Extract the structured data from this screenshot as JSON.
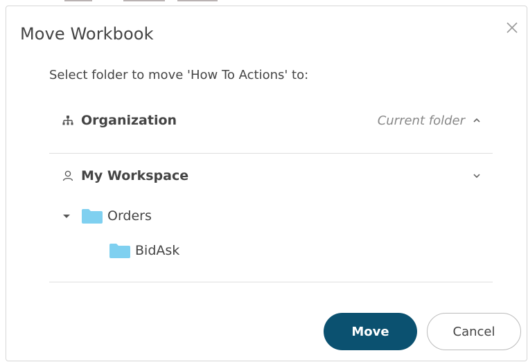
{
  "dialog": {
    "title": "Move Workbook",
    "prompt": "Select folder to move 'How To Actions' to:"
  },
  "folders": {
    "organization": {
      "label": "Organization",
      "status": "Current folder",
      "icon": "org-chart-icon"
    },
    "my_workspace": {
      "label": "My Workspace",
      "icon": "user-icon",
      "children": [
        {
          "label": "Orders",
          "expanded": true,
          "icon": "folder-icon"
        },
        {
          "label": "BidAsk",
          "icon": "folder-icon"
        }
      ]
    }
  },
  "buttons": {
    "move": "Move",
    "cancel": "Cancel"
  },
  "colors": {
    "primary": "#0b5170",
    "folder": "#7fd0f0",
    "divider": "#dedede"
  }
}
